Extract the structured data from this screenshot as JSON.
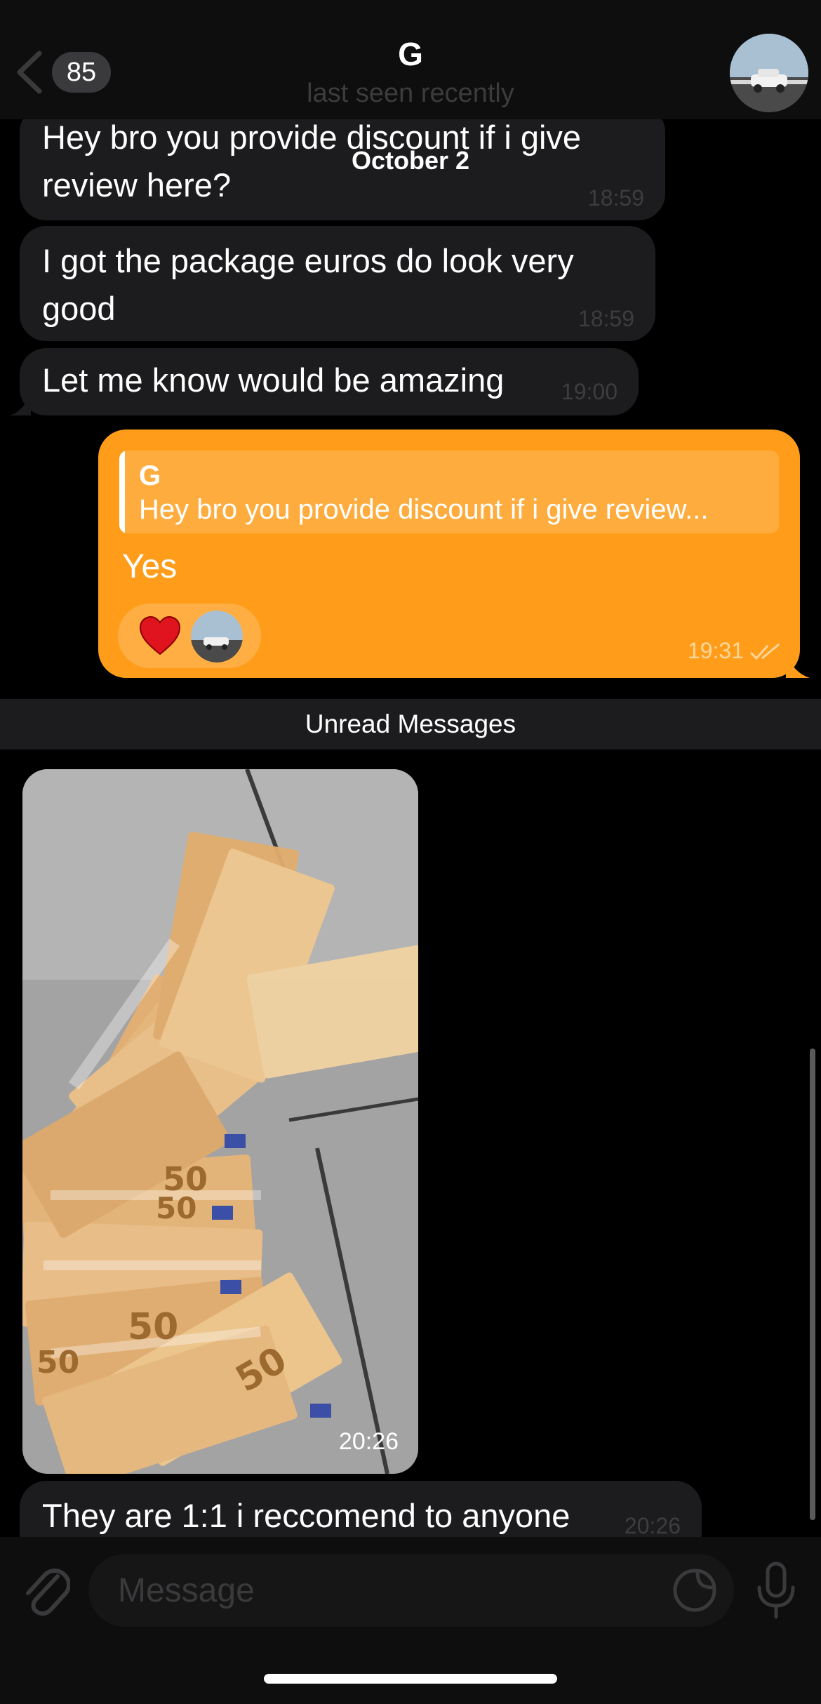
{
  "header": {
    "back_count": "85",
    "contact_name": "G",
    "contact_status": "last seen recently"
  },
  "date_separator": "October 2",
  "messages": [
    {
      "text_line1": "Hey bro you provide discount if i give",
      "text_line2": "review here?",
      "time": "18:59"
    },
    {
      "text_line1": "I got the package euros do look very",
      "text_line2": "good",
      "time": "18:59"
    },
    {
      "text_line1": "Let me know would be amazing",
      "time": "19:00"
    }
  ],
  "outgoing": {
    "reply_name": "G",
    "reply_text": "Hey bro you provide discount if i give review...",
    "text": "Yes",
    "time": "19:31",
    "reaction": "heart"
  },
  "unread_label": "Unread Messages",
  "photo": {
    "time": "20:26"
  },
  "last_message": {
    "text": "They are 1:1 i reccomend to anyone",
    "time": "20:26"
  },
  "input": {
    "placeholder": "Message"
  },
  "icons": {
    "back": "chevron-left-icon",
    "attach": "paperclip-icon",
    "sticker": "sticker-icon",
    "mic": "microphone-icon",
    "read": "double-check-icon"
  },
  "colors": {
    "accent": "#ff9d1b",
    "incoming_bubble": "#1c1c1e",
    "background": "#000000"
  }
}
